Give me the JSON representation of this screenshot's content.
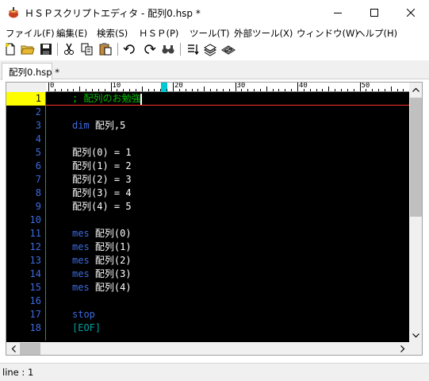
{
  "window": {
    "title": "ＨＳＰスクリプトエディタ - 配列0.hsp *",
    "app_icon": "hsp-pot-icon",
    "controls": [
      "minimize-icon",
      "maximize-icon",
      "close-icon"
    ]
  },
  "menu": {
    "items": [
      {
        "label": "ファイル(F)"
      },
      {
        "label": "編集(E)"
      },
      {
        "label": "検索(S)"
      },
      {
        "label": "ＨＳＰ(P)"
      },
      {
        "label": "ツール(T)"
      },
      {
        "label": "外部ツール(X)"
      },
      {
        "label": "ウィンドウ(W)"
      },
      {
        "label": "ヘルプ(H)"
      }
    ]
  },
  "toolbar": {
    "buttons": [
      "new-file-icon",
      "open-folder-icon",
      "save-icon",
      "cut-icon",
      "copy-icon",
      "paste-icon",
      "undo-icon",
      "redo-icon",
      "find-icon",
      "run-icon",
      "compile-icon",
      "build-icon"
    ]
  },
  "tabs": [
    {
      "label": "配列0.hsp *"
    }
  ],
  "ruler": {
    "labels": [
      "0",
      "10",
      "20",
      "30",
      "40",
      "50"
    ]
  },
  "editor": {
    "current_line": 1,
    "lines": [
      {
        "no": "1",
        "tokens": [
          {
            "t": "; 配列のお勉強",
            "c": "cmt"
          }
        ]
      },
      {
        "no": "2",
        "tokens": []
      },
      {
        "no": "3",
        "tokens": [
          {
            "t": "dim ",
            "c": "kw"
          },
          {
            "t": "配列,5",
            "c": "txt"
          }
        ]
      },
      {
        "no": "4",
        "tokens": []
      },
      {
        "no": "5",
        "tokens": [
          {
            "t": "配列(0) = 1",
            "c": "txt"
          }
        ]
      },
      {
        "no": "6",
        "tokens": [
          {
            "t": "配列(1) = 2",
            "c": "txt"
          }
        ]
      },
      {
        "no": "7",
        "tokens": [
          {
            "t": "配列(2) = 3",
            "c": "txt"
          }
        ]
      },
      {
        "no": "8",
        "tokens": [
          {
            "t": "配列(3) = 4",
            "c": "txt"
          }
        ]
      },
      {
        "no": "9",
        "tokens": [
          {
            "t": "配列(4) = 5",
            "c": "txt"
          }
        ]
      },
      {
        "no": "10",
        "tokens": []
      },
      {
        "no": "11",
        "tokens": [
          {
            "t": "mes ",
            "c": "kw"
          },
          {
            "t": "配列(0)",
            "c": "txt"
          }
        ]
      },
      {
        "no": "12",
        "tokens": [
          {
            "t": "mes ",
            "c": "kw"
          },
          {
            "t": "配列(1)",
            "c": "txt"
          }
        ]
      },
      {
        "no": "13",
        "tokens": [
          {
            "t": "mes ",
            "c": "kw"
          },
          {
            "t": "配列(2)",
            "c": "txt"
          }
        ]
      },
      {
        "no": "14",
        "tokens": [
          {
            "t": "mes ",
            "c": "kw"
          },
          {
            "t": "配列(3)",
            "c": "txt"
          }
        ]
      },
      {
        "no": "15",
        "tokens": [
          {
            "t": "mes ",
            "c": "kw"
          },
          {
            "t": "配列(4)",
            "c": "txt"
          }
        ]
      },
      {
        "no": "16",
        "tokens": []
      },
      {
        "no": "17",
        "tokens": [
          {
            "t": "stop",
            "c": "kw"
          }
        ]
      },
      {
        "no": "18",
        "tokens": [
          {
            "t": "[EOF]",
            "c": "eof"
          }
        ]
      }
    ]
  },
  "status": {
    "text": "line : 1"
  },
  "colors": {
    "editor_bg": "#000000",
    "keyword": "#3d6be0",
    "comment": "#00c000",
    "current_line_marker": "#fffe00",
    "cursor_line_underline": "#ff3030"
  }
}
